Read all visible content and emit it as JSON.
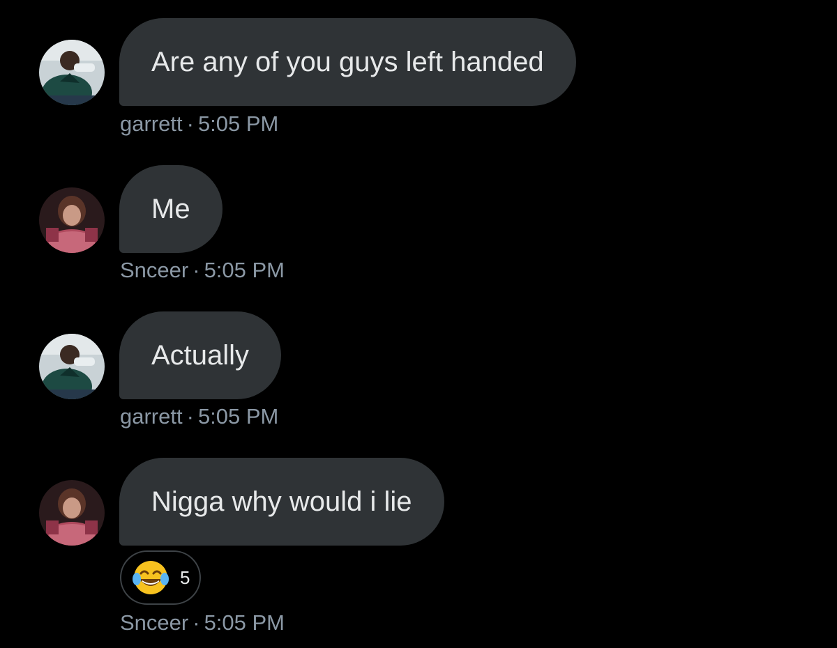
{
  "messages": [
    {
      "text": "Are any of you guys left handed",
      "sender": "garrett",
      "separator": "·",
      "time": "5:05 PM",
      "avatar_icon": "football-player-avatar-icon"
    },
    {
      "text": "Me",
      "sender": "Snceer",
      "separator": "·",
      "time": "5:05 PM",
      "avatar_icon": "woman-portrait-avatar-icon"
    },
    {
      "text": "Actually",
      "sender": "garrett",
      "separator": "·",
      "time": "5:05 PM",
      "avatar_icon": "football-player-avatar-icon"
    },
    {
      "text": "Nigga why would i lie",
      "sender": "Snceer",
      "separator": "·",
      "time": "5:05 PM",
      "avatar_icon": "woman-portrait-avatar-icon",
      "reaction": {
        "emoji_icon": "face-with-tears-of-joy-icon",
        "count": "5"
      }
    }
  ],
  "colors": {
    "background": "#000000",
    "bubble": "#2f3336",
    "message_text": "#e7e9ea",
    "meta_text": "#8b98a5"
  }
}
